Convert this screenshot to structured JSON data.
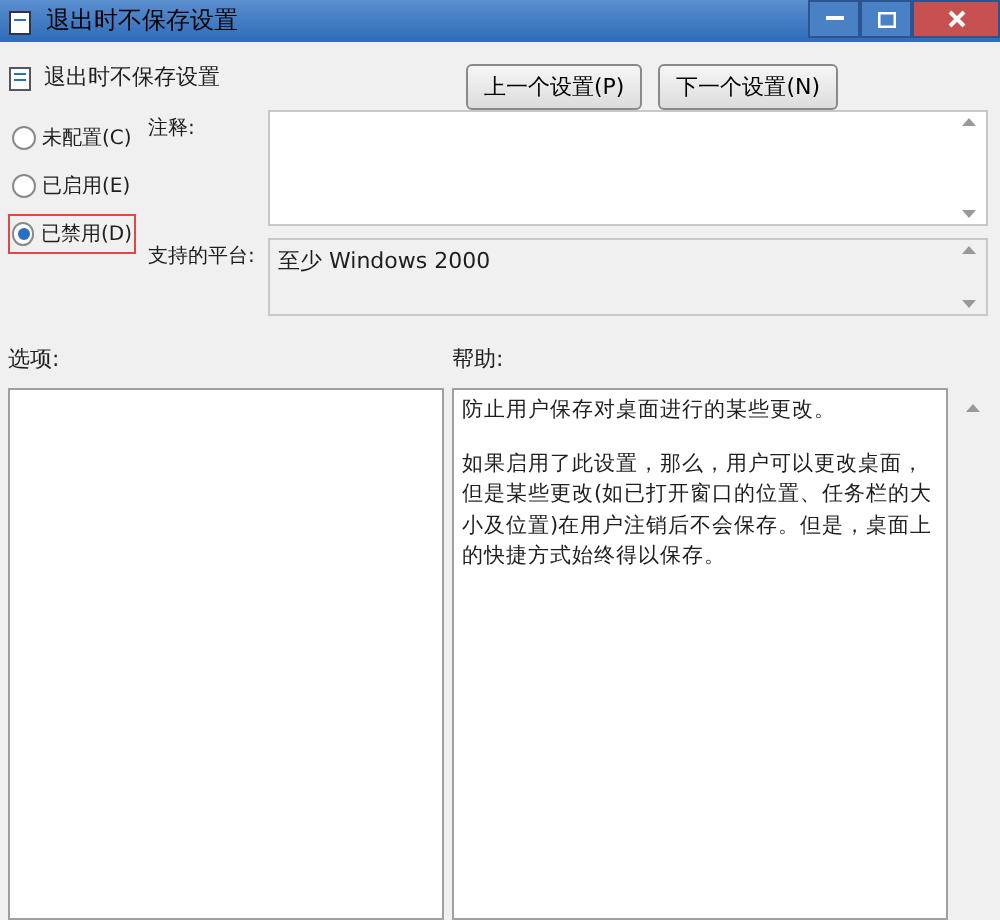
{
  "window": {
    "title": "退出时不保存设置"
  },
  "header": {
    "title": "退出时不保存设置"
  },
  "buttons": [
    {
      "label": "上一个设置(P)"
    },
    {
      "label": "下一个设置(N)"
    }
  ],
  "options": [
    {
      "label": "未配置(C)",
      "selected": false
    },
    {
      "label": "已启用(E)",
      "selected": false
    },
    {
      "label": "已禁用(D)",
      "selected": true
    }
  ],
  "comment": {
    "label": "注释:"
  },
  "platform": {
    "label": "支持的平台:",
    "value": "至少 Windows 2000"
  },
  "options_panel": {
    "label": "选项:"
  },
  "help": {
    "label": "帮助:",
    "paragraphs": [
      "防止用户保存对桌面进行的某些更改。",
      "如果启用了此设置，那么，用户可以更改桌面，但是某些更改(如已打开窗口的位置、任务栏的大小及位置)在用户注销后不会保存。但是，桌面上的快捷方式始终得以保存。"
    ]
  }
}
